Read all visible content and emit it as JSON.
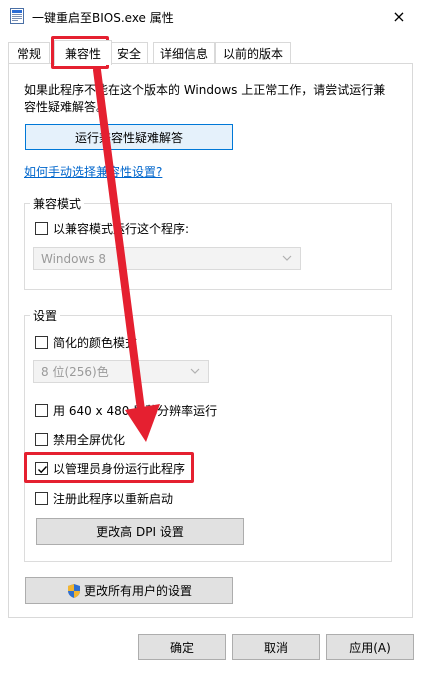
{
  "window": {
    "title": "一键重启至BIOS.exe 属性",
    "close_icon": "×"
  },
  "tabs": [
    {
      "label": "常规"
    },
    {
      "label": "兼容性"
    },
    {
      "label": "安全"
    },
    {
      "label": "详细信息"
    },
    {
      "label": "以前的版本"
    }
  ],
  "content": {
    "description": "如果此程序不能在这个版本的 Windows 上正常工作，请尝试运行兼容性疑难解答。",
    "troubleshoot_button": "运行兼容性疑难解答",
    "manual_link": "如何手动选择兼容性设置?",
    "compat_mode": {
      "title": "兼容模式",
      "checkbox": "以兼容模式运行这个程序:",
      "checked": false,
      "select_value": "Windows 8"
    },
    "settings": {
      "title": "设置",
      "reduced_color": {
        "label": "简化的颜色模式",
        "checked": false
      },
      "color_select": "8 位(256)色",
      "res_640": {
        "label": "用 640 x 480 屏幕分辨率运行",
        "checked": false
      },
      "disable_fullscreen": {
        "label": "禁用全屏优化",
        "checked": false
      },
      "run_as_admin": {
        "label": "以管理员身份运行此程序",
        "checked": true
      },
      "register_restart": {
        "label": "注册此程序以重新启动",
        "checked": false
      },
      "dpi_button": "更改高 DPI 设置"
    },
    "all_users_button": "更改所有用户的设置"
  },
  "footer": {
    "ok": "确定",
    "cancel": "取消",
    "apply": "应用(A)"
  },
  "colors": {
    "annotation": "#e52030",
    "link": "#0066cc",
    "focus": "#0078d7"
  }
}
